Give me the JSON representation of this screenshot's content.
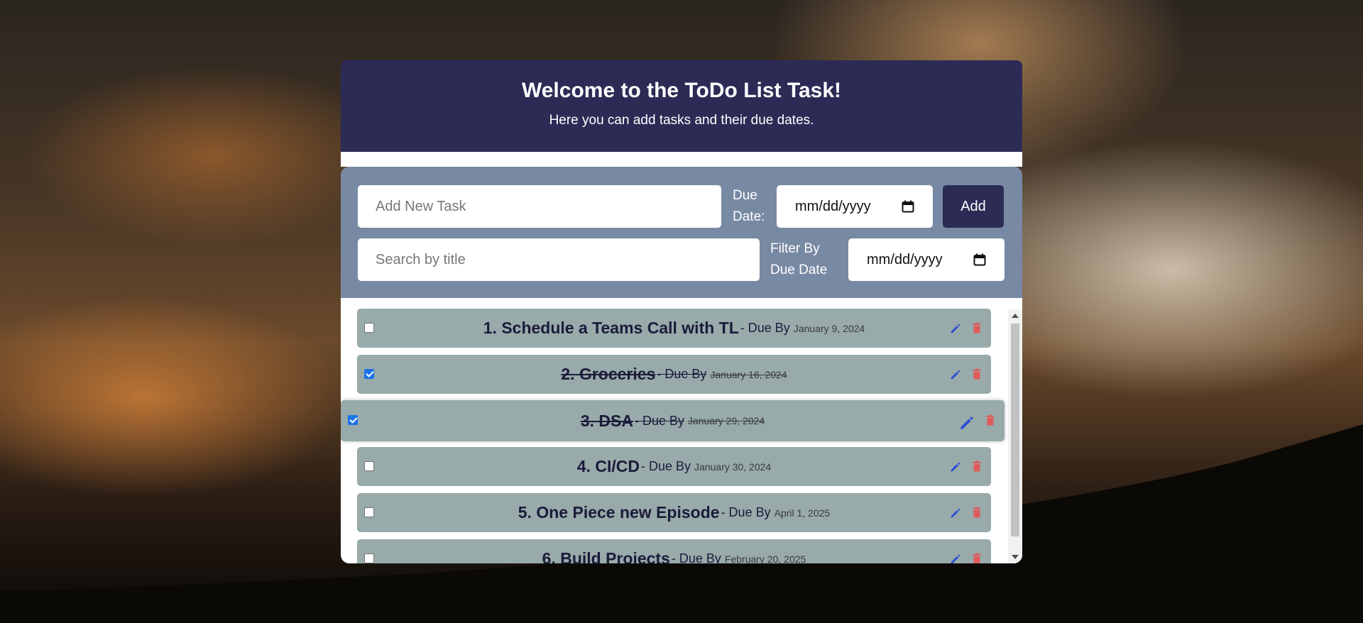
{
  "header": {
    "title": "Welcome to the ToDo List Task!",
    "subtitle": "Here you can add tasks and their due dates."
  },
  "form": {
    "task_placeholder": "Add New Task",
    "due_label_line1": "Due",
    "due_label_line2": "Date:",
    "due_value": "mm/dd/yyyy",
    "add_label": "Add",
    "search_placeholder": "Search by title",
    "filter_label_line1": "Filter By",
    "filter_label_line2": "Due Date",
    "filter_value": "mm/dd/yyyy"
  },
  "tasks": [
    {
      "title": "1. Schedule a Teams Call with TL",
      "due_prefix": "- Due By",
      "date": "January 9, 2024",
      "done": false
    },
    {
      "title": "2. Groceries",
      "due_prefix": "- Due By",
      "date": "January 16, 2024",
      "done": true
    },
    {
      "title": "3. DSA",
      "due_prefix": "- Due By",
      "date": "January 29, 2024",
      "done": true
    },
    {
      "title": "4. CI/CD",
      "due_prefix": "- Due By",
      "date": "January 30, 2024",
      "done": false
    },
    {
      "title": "5. One Piece new Episode",
      "due_prefix": "- Due By",
      "date": "April 1, 2025",
      "done": false
    },
    {
      "title": "6. Build Projects",
      "due_prefix": "- Due By",
      "date": "February 20, 2025",
      "done": false
    }
  ],
  "icons": {
    "edit": "pencil-icon",
    "delete": "trash-icon",
    "calendar": "calendar-icon"
  },
  "colors": {
    "header_bg": "#2b2b55",
    "form_bg": "#7889a3",
    "row_bg": "#98aaaa",
    "edit": "#2a4ad8",
    "delete": "#e05a5a"
  }
}
